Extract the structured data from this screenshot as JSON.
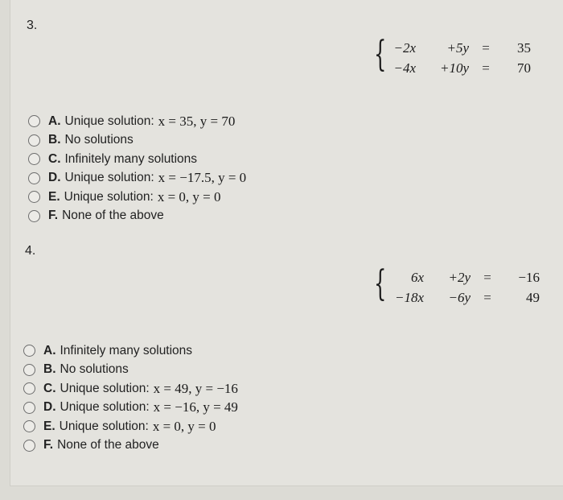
{
  "questions": [
    {
      "number": "3.",
      "system": {
        "rows": [
          {
            "x_term": "−2x",
            "y_term": "+5y",
            "eq": "=",
            "rhs": "35"
          },
          {
            "x_term": "−4x",
            "y_term": "+10y",
            "eq": "=",
            "rhs": "70"
          }
        ]
      },
      "options": [
        {
          "letter": "A.",
          "text": "Unique solution:",
          "math": "x = 35,  y = 70"
        },
        {
          "letter": "B.",
          "text": "No solutions",
          "math": ""
        },
        {
          "letter": "C.",
          "text": "Infinitely many solutions",
          "math": ""
        },
        {
          "letter": "D.",
          "text": "Unique solution:",
          "math": "x = −17.5,  y = 0"
        },
        {
          "letter": "E.",
          "text": "Unique solution:",
          "math": "x = 0,  y = 0"
        },
        {
          "letter": "F.",
          "text": "None of the above",
          "math": ""
        }
      ]
    },
    {
      "number": "4.",
      "system": {
        "rows": [
          {
            "x_term": "6x",
            "y_term": "+2y",
            "eq": "=",
            "rhs": "−16"
          },
          {
            "x_term": "−18x",
            "y_term": "−6y",
            "eq": "=",
            "rhs": "49"
          }
        ]
      },
      "options": [
        {
          "letter": "A.",
          "text": "Infinitely many solutions",
          "math": ""
        },
        {
          "letter": "B.",
          "text": "No solutions",
          "math": ""
        },
        {
          "letter": "C.",
          "text": "Unique solution:",
          "math": "x = 49,  y = −16"
        },
        {
          "letter": "D.",
          "text": "Unique solution:",
          "math": "x = −16,  y = 49"
        },
        {
          "letter": "E.",
          "text": "Unique solution:",
          "math": "x = 0,  y = 0"
        },
        {
          "letter": "F.",
          "text": "None of the above",
          "math": ""
        }
      ]
    }
  ]
}
